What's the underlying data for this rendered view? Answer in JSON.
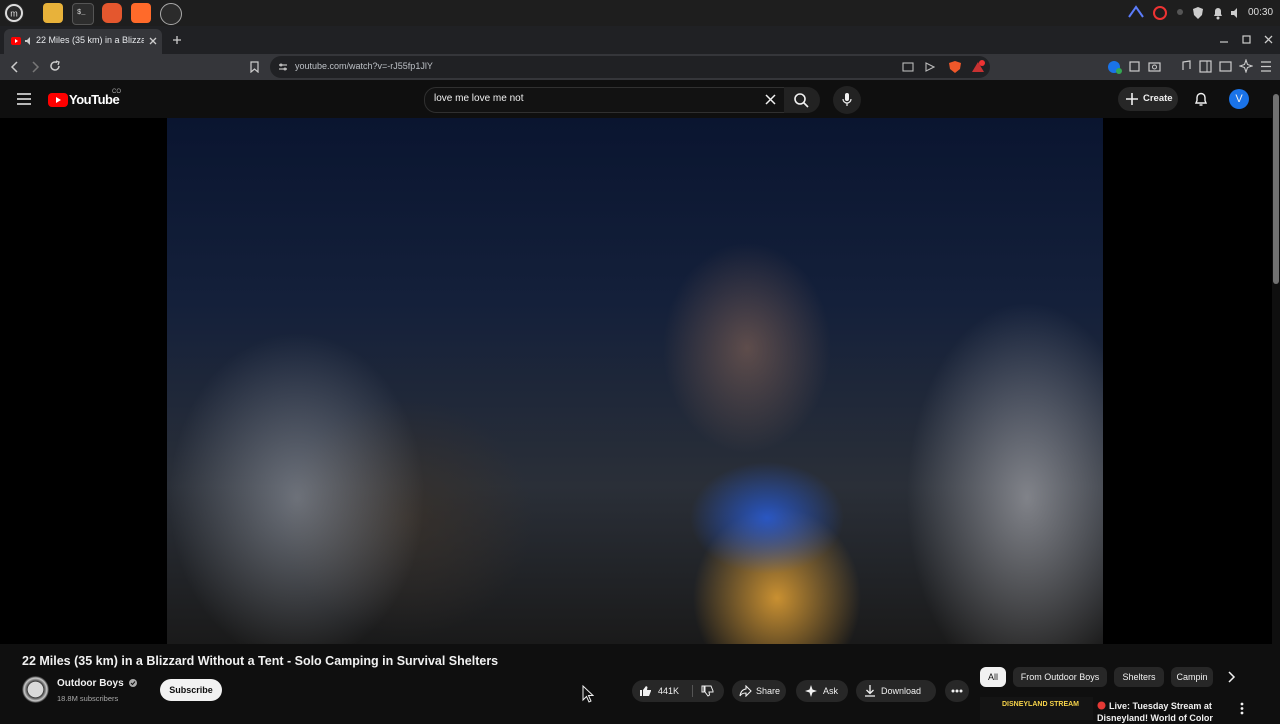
{
  "os": {
    "clock": "00:30",
    "taskbar_apps": [
      "mint-menu",
      "files",
      "terminal",
      "firefox",
      "brave",
      "app"
    ]
  },
  "browser": {
    "tab_title": "22 Miles (35 km) in a Blizza",
    "url": "youtube.com/watch?v=-rJ55fp1JlY"
  },
  "youtube": {
    "logo_text": "YouTube",
    "logo_superscript": "CO",
    "search_value": "love me love me not",
    "create_label": "Create",
    "avatar_letter": "V"
  },
  "video": {
    "title": "22 Miles (35 km) in a Blizzard Without a Tent - Solo Camping in Survival Shelters",
    "channel": "Outdoor Boys",
    "subscribers": "18.8M subscribers",
    "subscribe_label": "Subscribe",
    "likes": "441K",
    "share_label": "Share",
    "ask_label": "Ask",
    "download_label": "Download"
  },
  "chips": [
    "All",
    "From Outdoor Boys",
    "Shelters",
    "Campin"
  ],
  "recommendation": {
    "thumb_label": "DISNEYLAND STREAM",
    "title": "Live: Tuesday Stream at Disneyland! World of Color"
  },
  "colors": {
    "yt_red": "#ff0000",
    "background": "#0f0f0f",
    "avatar_blue": "#1a73e8"
  }
}
